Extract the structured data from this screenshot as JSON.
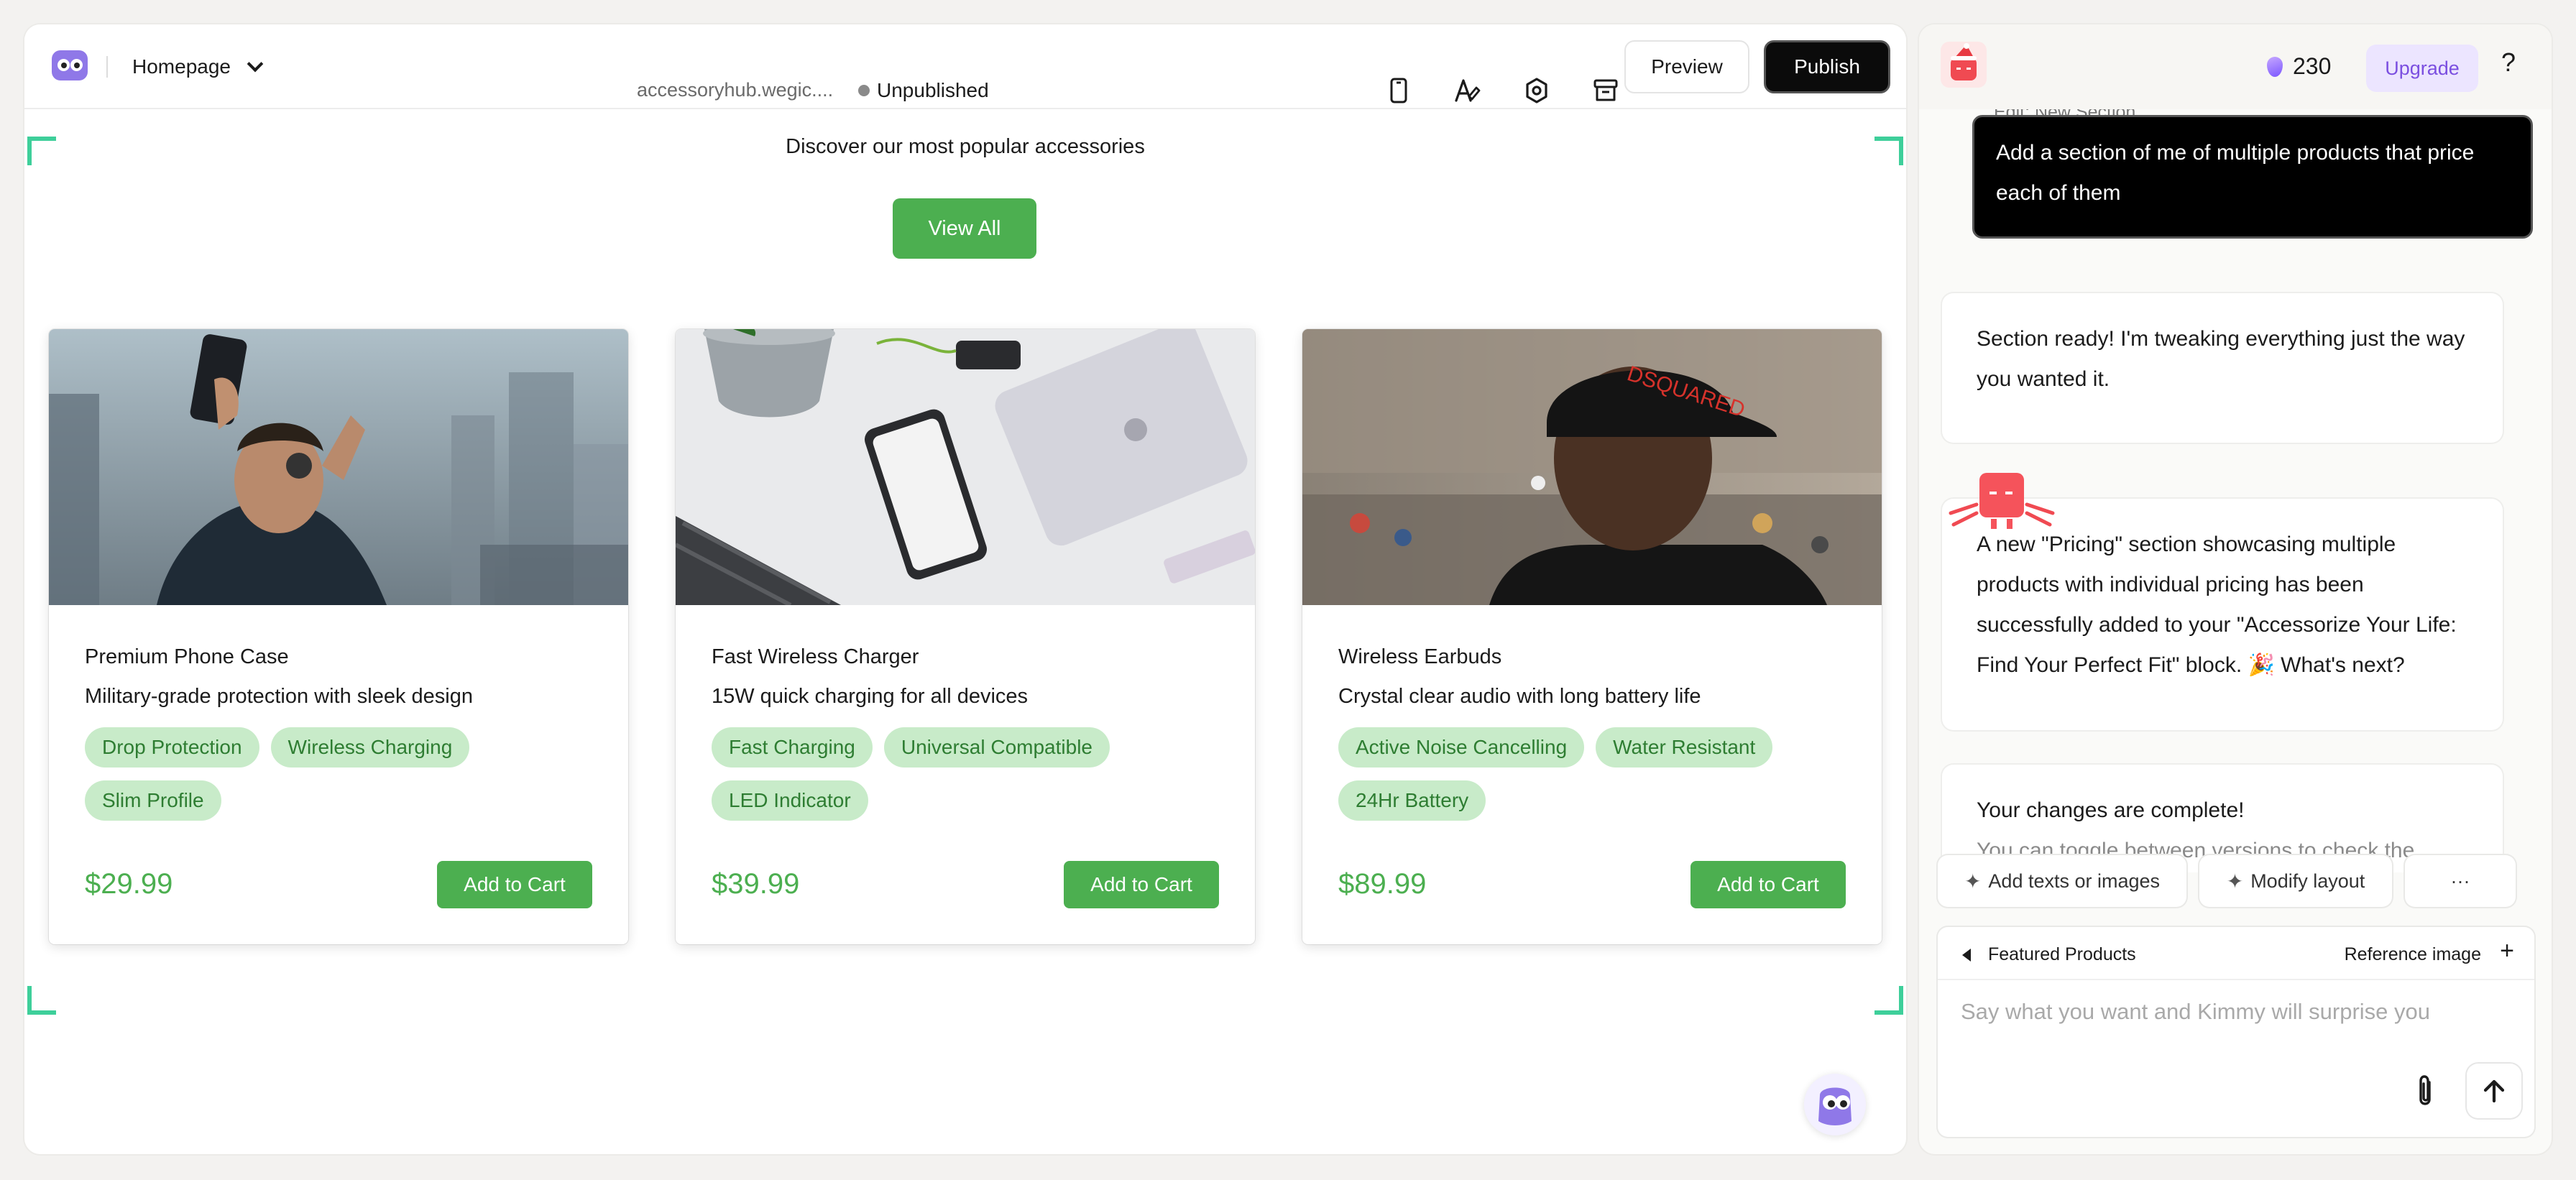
{
  "topbar": {
    "page_selector": "Homepage",
    "domain": "accessoryhub.wegic....",
    "status": "Unpublished",
    "icons": [
      "mobile-preview-icon",
      "font-style-icon",
      "settings-icon",
      "archive-icon"
    ],
    "preview_label": "Preview",
    "publish_label": "Publish"
  },
  "canvas": {
    "subtitle": "Discover our most popular accessories",
    "view_all_label": "View All",
    "accent_color": "#4caf50",
    "products": [
      {
        "title": "Premium Phone Case",
        "description": "Military-grade protection with sleek design",
        "tags": [
          "Drop Protection",
          "Wireless Charging",
          "Slim Profile"
        ],
        "price": "$29.99",
        "cta": "Add to Cart"
      },
      {
        "title": "Fast Wireless Charger",
        "description": "15W quick charging for all devices",
        "tags": [
          "Fast Charging",
          "Universal Compatible",
          "LED Indicator"
        ],
        "price": "$39.99",
        "cta": "Add to Cart"
      },
      {
        "title": "Wireless Earbuds",
        "description": "Crystal clear audio with long battery life",
        "tags": [
          "Active Noise Cancelling",
          "Water Resistant",
          "24Hr Battery"
        ],
        "price": "$89.99",
        "cta": "Add to Cart"
      }
    ]
  },
  "chat": {
    "credits": "230",
    "upgrade_label": "Upgrade",
    "help_label": "?",
    "edit_label": "Edit:  New Section",
    "user_message": "Add a section of me of multiple products that price each of them",
    "bot_messages": [
      "Section ready! I'm tweaking everything just the way you wanted it.",
      "A new \"Pricing\" section showcasing multiple products with individual pricing has been successfully added to your \"Accessorize Your Life: Find Your Perfect Fit\" block. 🎉 What's next?",
      "Your changes are complete!"
    ],
    "bot_message_faded": "You can toggle between versions to check the",
    "chips": [
      "Add texts or images",
      "Modify layout",
      "···"
    ],
    "composer": {
      "context": "Featured Products",
      "reference_label": "Reference image",
      "plus_label": "+",
      "placeholder": "Say what you want and Kimmy will surprise you"
    }
  }
}
